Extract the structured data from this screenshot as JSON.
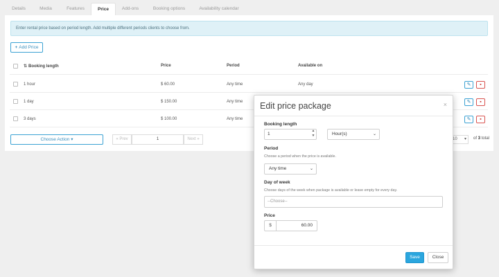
{
  "tabs": [
    {
      "label": "Details"
    },
    {
      "label": "Media"
    },
    {
      "label": "Features"
    },
    {
      "label": "Price"
    },
    {
      "label": "Add-ons"
    },
    {
      "label": "Booking options"
    },
    {
      "label": "Availability calendar"
    }
  ],
  "info_text": "Enter rental price based on period length. Add multiple different periods clients to choose from.",
  "add_price_label": "Add Price",
  "table": {
    "headers": {
      "booking_length": "Booking length",
      "price": "Price",
      "period": "Period",
      "available_on": "Available on"
    },
    "rows": [
      {
        "length": "1 hour",
        "price": "$ 60.00",
        "period": "Any time",
        "available": "Any day"
      },
      {
        "length": "1 day",
        "price": "$ 150.00",
        "period": "Any time",
        "available": ""
      },
      {
        "length": "3 days",
        "price": "$ 100.00",
        "period": "Any time",
        "available": ""
      }
    ]
  },
  "choose_action_label": "Choose Action",
  "pagination": {
    "prev": "« Prev",
    "page": "1",
    "next": "Next »",
    "per_page": "10",
    "of_label": "of",
    "total_count": "3",
    "total_label": "total"
  },
  "modal": {
    "title": "Edit price package",
    "close_x": "×",
    "booking_length_label": "Booking length",
    "booking_length_value": "1",
    "unit_value": "Hour(s)",
    "period_label": "Period",
    "period_help": "Choose a period when the price is available.",
    "period_value": "Any time",
    "dow_label": "Day of week",
    "dow_help": "Choose days of the week when package is available or leave empty for every day.",
    "dow_placeholder": "--Choose--",
    "price_label": "Price",
    "currency": "$",
    "price_value": "60.00",
    "save_label": "Save",
    "close_label": "Close"
  },
  "colors": {
    "accent": "#2ba6de",
    "danger": "#d9534f",
    "info_bg": "#dff1f7"
  }
}
